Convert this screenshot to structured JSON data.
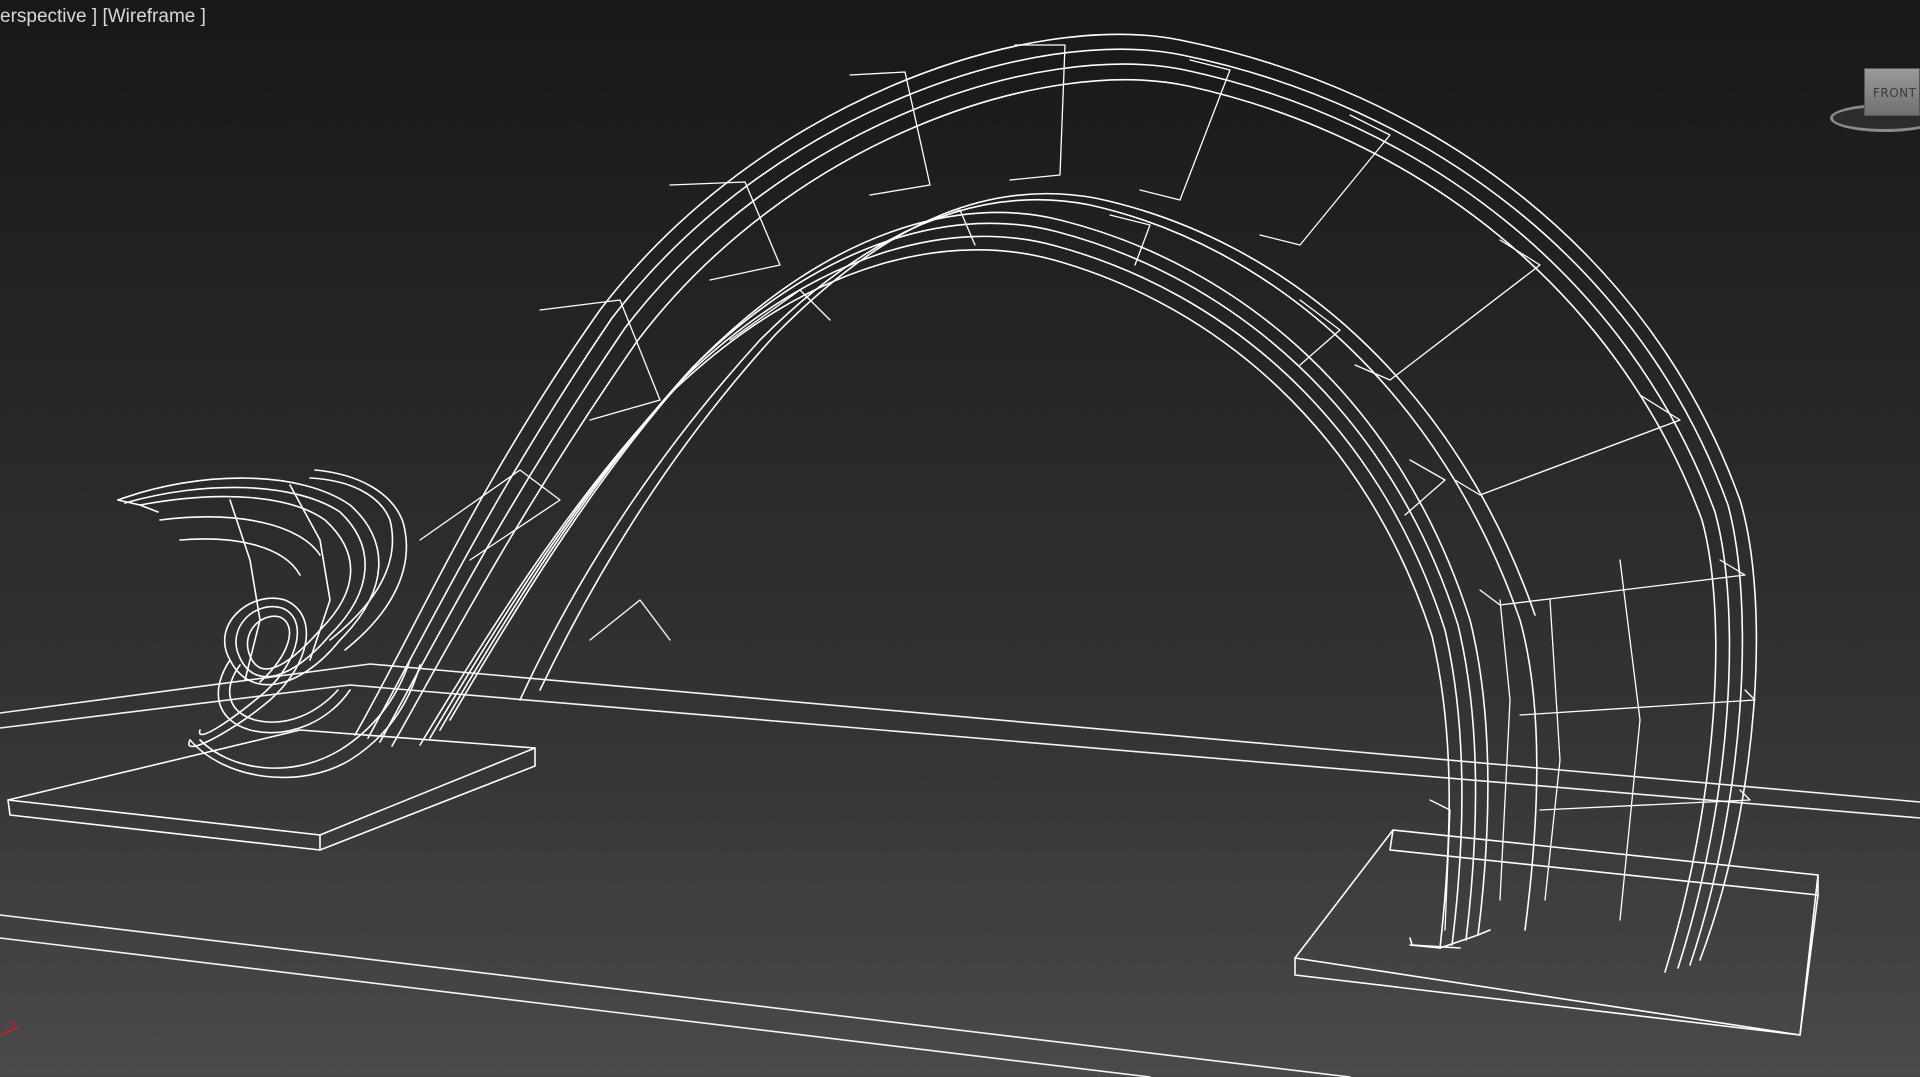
{
  "viewport": {
    "label_prefix": "erspective ]",
    "label_mode": "[Wireframe ]",
    "mode": "Wireframe",
    "view": "Perspective"
  },
  "viewcube": {
    "face_label": "FRONT"
  },
  "axis_tripod": {
    "x_label": "x"
  },
  "colors": {
    "background_top": "#181818",
    "background_bottom": "#4a4a4a",
    "wireframe": "#ffffff",
    "axis_x": "#c81e1e"
  }
}
